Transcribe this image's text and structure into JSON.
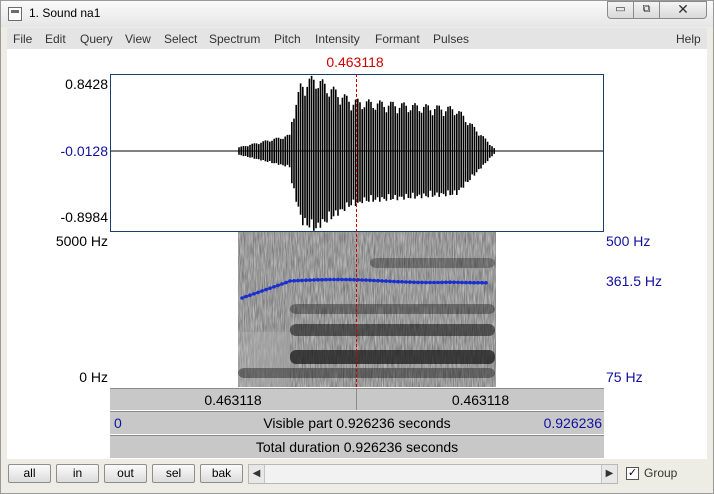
{
  "window": {
    "title": "1. Sound na1"
  },
  "window_controls": {
    "minimize": "▭",
    "maximize": "⧉",
    "close": "✕"
  },
  "menu": [
    {
      "label": "File"
    },
    {
      "label": "Edit"
    },
    {
      "label": "Query"
    },
    {
      "label": "View"
    },
    {
      "label": "Select"
    },
    {
      "label": "Spectrum"
    },
    {
      "label": "Pitch"
    },
    {
      "label": "Intensity"
    },
    {
      "label": "Formant"
    },
    {
      "label": "Pulses"
    },
    {
      "label": "Help"
    }
  ],
  "cursor_time": "0.463118",
  "waveform": {
    "y_top": "0.8428",
    "y_mid": "-0.0128",
    "y_bottom": "-0.8984"
  },
  "spectrogram": {
    "freq_top": "5000 Hz",
    "freq_bottom": "0 Hz",
    "pitch_top": "500 Hz",
    "pitch_value": "361.5 Hz",
    "pitch_bottom": "75 Hz"
  },
  "selection": {
    "left": "0.463118",
    "right": "0.463118"
  },
  "visible": {
    "start": "0",
    "label": "Visible part 0.926236 seconds",
    "end": "0.926236"
  },
  "total": {
    "label": "Total duration 0.926236 seconds"
  },
  "buttons": {
    "all": "all",
    "in": "in",
    "out": "out",
    "sel": "sel",
    "bak": "bak"
  },
  "scroll": {
    "left": "◀",
    "right": "▶"
  },
  "group": {
    "label": "Group",
    "checked": "✓"
  },
  "colors": {
    "cursor": "#cc0000",
    "pitch": "#1a2fd0",
    "axis_blue": "#1010a0"
  }
}
